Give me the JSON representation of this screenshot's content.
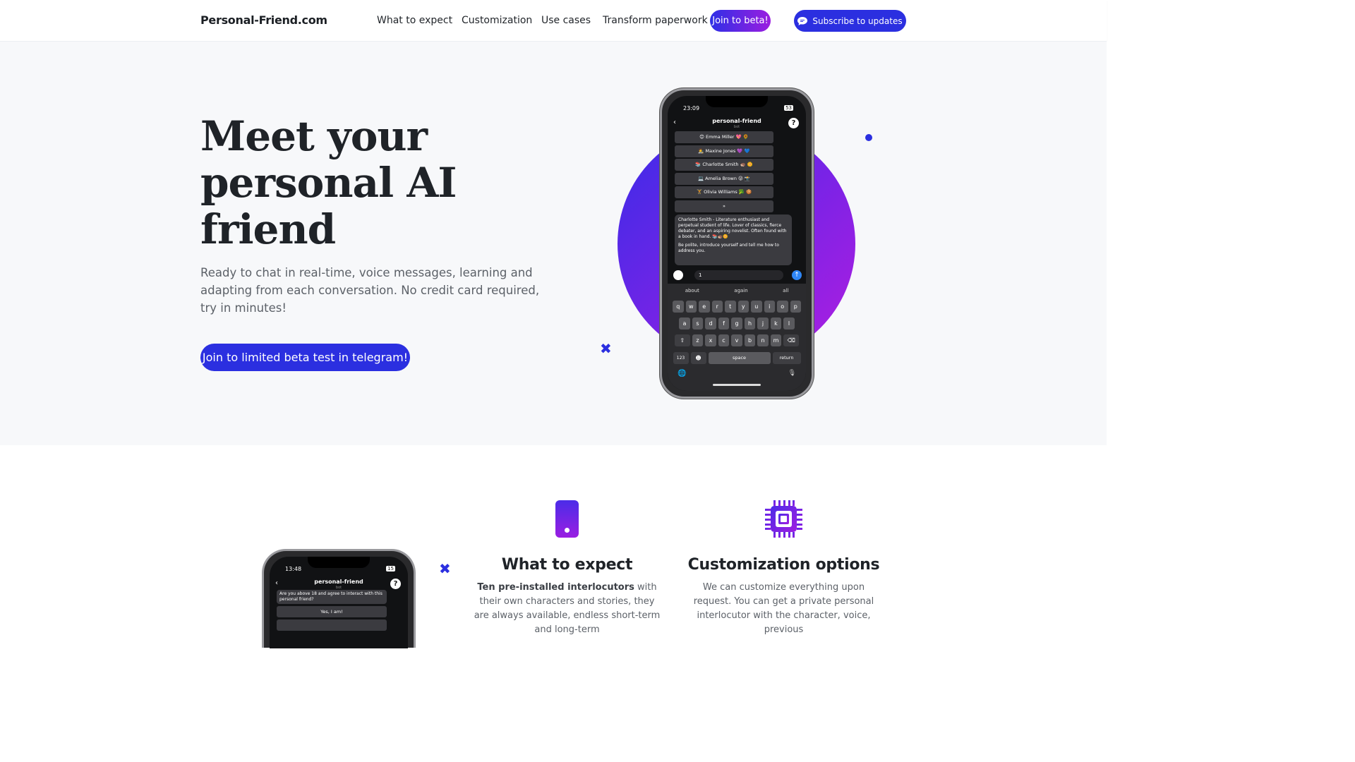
{
  "nav": {
    "brand": "Personal-Friend.com",
    "links": [
      "What to expect",
      "Customization",
      "Use cases",
      "Transform paperwork"
    ],
    "beta": "Join to beta!",
    "subscribe": "Subscribe to updates"
  },
  "hero": {
    "title": "Meet your personal AI friend",
    "subtitle": "Ready to chat in real-time, voice messages, learning and adapting from each conversation. No credit card required, try in minutes!",
    "cta": "Join to limited beta test in telegram!"
  },
  "phone": {
    "time": "23:09",
    "battery": "53",
    "title": "personal-friend",
    "bot_label": "bot",
    "list": [
      "😊 Emma Miller 💖 🌻",
      "👩‍🎨 Maxine Jones 💜 💙",
      "📚 Charlotte Smith 🦔 🌼",
      "💻 Amelia Brown 😜 📸",
      "🏋 Olivia Williams 🥦 🍪",
      "»"
    ],
    "message_1": "Charlotte Smith - Literature enthusiast and perpetual student of life. Lover of classics, fierce debater, and an aspiring novelist. Often found with a book in hand. 📚🦔🌼",
    "message_2": "Be polite, introduce yourself and tell me how to address you.",
    "input_value": "1",
    "suggestions": [
      "about",
      "again",
      "all"
    ],
    "row1": [
      "q",
      "w",
      "e",
      "r",
      "t",
      "y",
      "u",
      "i",
      "o",
      "p"
    ],
    "row2": [
      "a",
      "s",
      "d",
      "f",
      "g",
      "h",
      "j",
      "k",
      "l"
    ],
    "row3": [
      "z",
      "x",
      "c",
      "v",
      "b",
      "n",
      "m"
    ],
    "num_key": "123",
    "space_key": "space",
    "return_key": "return"
  },
  "phone2": {
    "time": "13:48",
    "battery": "15",
    "title": "personal-friend",
    "bot_label": "bot",
    "question": "Are you above 18 and agree to interact with this personal friend?",
    "answer": "Yes, I am!"
  },
  "features": [
    {
      "title": "What to expect",
      "bold": "Ten pre-installed interlocutors",
      "text": " with their own characters and stories, they are always available, endless short-term and long-term"
    },
    {
      "title": "Customization options",
      "text": "We can customize everything upon request. You can get a private personal interlocutor with the character, voice, previous"
    }
  ],
  "colors": {
    "accent": "#2b2fe0",
    "gradient_end": "#9b1de0",
    "hero_bg": "#f7f8fa"
  }
}
